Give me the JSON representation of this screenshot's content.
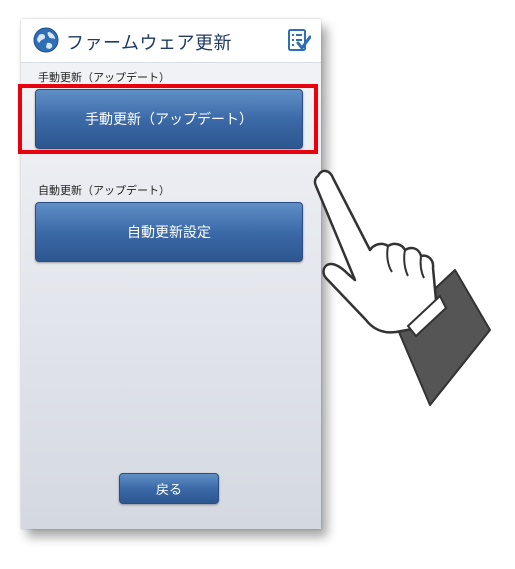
{
  "header": {
    "title": "ファームウェア更新",
    "globe_icon": "globe-icon",
    "checklist_icon": "checklist-icon"
  },
  "manual_section": {
    "label": "手動更新（アップデート）",
    "button_label": "手動更新（アップデート）"
  },
  "auto_section": {
    "label": "自動更新（アップデート）",
    "button_label": "自動更新設定"
  },
  "footer": {
    "back_label": "戻る"
  },
  "annotation": {
    "highlight_color": "#e8000c",
    "pointer": "pointing-hand-icon"
  },
  "colors": {
    "button_top": "#5f8fc6",
    "button_bottom": "#2c568f",
    "title_text": "#1f3a64"
  }
}
